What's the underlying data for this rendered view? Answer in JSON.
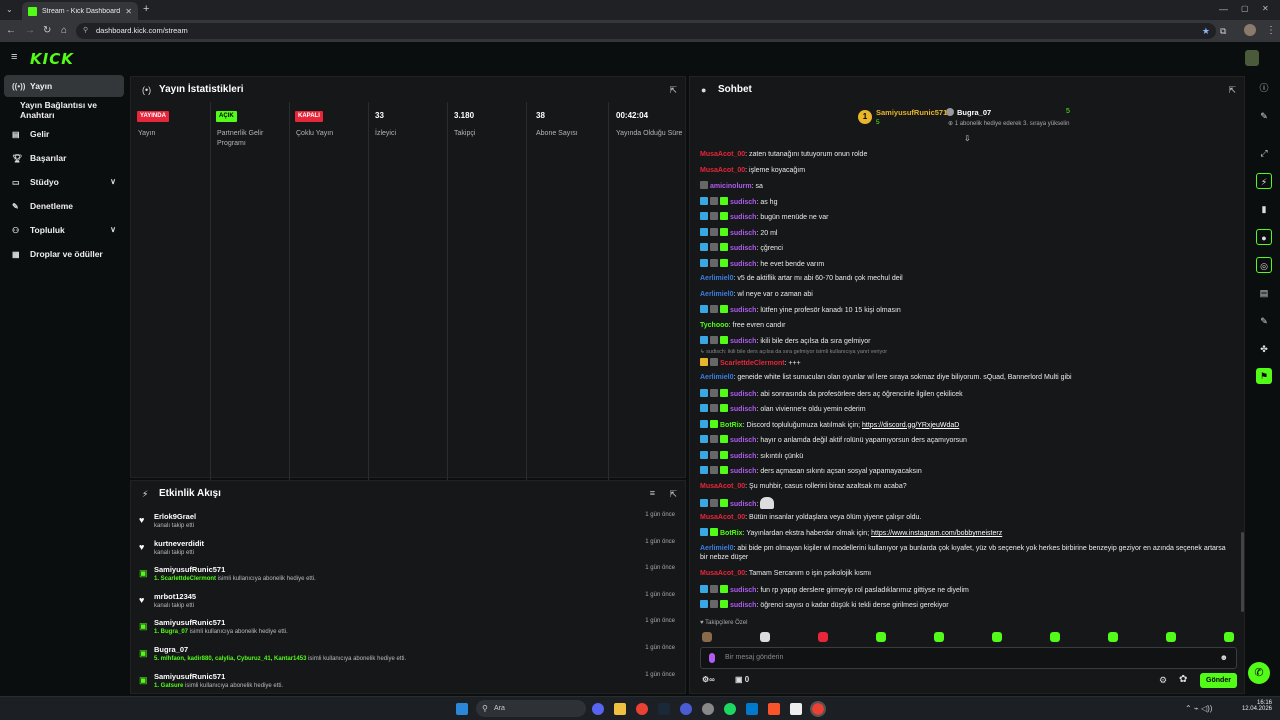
{
  "browser": {
    "tab_title": "Stream - Kick Dashboard",
    "url": "dashboard.kick.com/stream"
  },
  "brand": {
    "logo_text": "KICK",
    "accent": "#53fc18"
  },
  "sidebar": {
    "items": [
      {
        "label": "Yayın",
        "icon": "broadcast-icon",
        "active": true
      },
      {
        "label": "Yayın Bağlantısı ve Anahtarı",
        "icon": "",
        "active": false
      },
      {
        "label": "Gelir",
        "icon": "money-icon"
      },
      {
        "label": "Başarılar",
        "icon": "trophy-icon"
      },
      {
        "label": "Stüdyo",
        "icon": "studio-icon",
        "chevron": true
      },
      {
        "label": "Denetleme",
        "icon": "wrench-icon"
      },
      {
        "label": "Topluluk",
        "icon": "community-icon",
        "chevron": true
      },
      {
        "label": "Droplar ve ödüller",
        "icon": "drops-icon"
      }
    ]
  },
  "stats_panel": {
    "title": "Yayın İstatistikleri",
    "columns": [
      {
        "badge": "YAYINDA",
        "badge_color": "#e8263a",
        "label": "Yayın"
      },
      {
        "badge": "AÇIK",
        "badge_color": "#53fc18",
        "label": "Partnerlik Gelir Programı"
      },
      {
        "badge": "KAPALI",
        "badge_color": "#e8263a",
        "label": "Çoklu Yayın"
      },
      {
        "value": "33",
        "label": "İzleyici"
      },
      {
        "value": "3.180",
        "label": "Takipçi"
      },
      {
        "value": "38",
        "label": "Abone Sayısı"
      },
      {
        "value": "00:42:04",
        "label": "Yayında Olduğu Süre"
      }
    ]
  },
  "activity_panel": {
    "title": "Etkinlik Akışı",
    "items": [
      {
        "icon": "heart-icon",
        "name": "Erlok9Grael",
        "desc_pre": "",
        "desc_highlight": "",
        "desc": "kanalı takip etti",
        "time": "1 gün önce"
      },
      {
        "icon": "heart-icon",
        "name": "kurtneverdidit",
        "desc_pre": "",
        "desc_highlight": "",
        "desc": "kanalı takip etti",
        "time": "1 gün önce"
      },
      {
        "icon": "gift-icon",
        "name": "SamiyusufRunic571",
        "desc_highlight": "1. ScarlettdeClermont",
        "desc": " isimli kullanıcıya abonelik hediye etti.",
        "time": "1 gün önce"
      },
      {
        "icon": "heart-icon",
        "name": "mrbot12345",
        "desc_highlight": "",
        "desc": "kanalı takip etti",
        "time": "1 gün önce"
      },
      {
        "icon": "gift-icon",
        "name": "SamiyusufRunic571",
        "desc_highlight": "1. Bugra_07",
        "desc": " isimli kullanıcıya abonelik hediye etti.",
        "time": "1 gün önce"
      },
      {
        "icon": "gift-icon",
        "name": "Bugra_07",
        "desc_highlight": "5. mlhfaon, kadir880, calylia, Cyburuz_41, Kantar1453",
        "desc": " isimli kullanıcıya abonelik hediye etti.",
        "time": "1 gün önce"
      },
      {
        "icon": "gift-icon",
        "name": "SamiyusufRunic571",
        "desc_highlight": "1. Gatsure",
        "desc": " isimli kullanıcıya abonelik hediye etti.",
        "time": "1 gün önce"
      }
    ]
  },
  "chat_panel": {
    "title": "Sohbet",
    "leaderboard": {
      "rank": "1",
      "first_name": "SamiyusufRunic571",
      "first_count": "5",
      "second_name": "Bugra_07",
      "second_count": "5",
      "second_note": "1 abonelik hediye ederek 3. sıraya yükselin"
    },
    "messages": [
      {
        "badges": [],
        "user": "MusaAcot_00",
        "color": "#e8263a",
        "text": "zaten tutanağını tutuyorum onun rolde"
      },
      {
        "badges": [],
        "user": "MusaAcot_00",
        "color": "#e8263a",
        "text": "işleme koyacağım"
      },
      {
        "badges": [
          "gray"
        ],
        "user": "amicinolurm",
        "color": "#b05cf0",
        "text": "sa"
      },
      {
        "badges": [
          "blue",
          "gray",
          "green"
        ],
        "user": "sudisch",
        "color": "#b05cf0",
        "text": "as hg"
      },
      {
        "badges": [
          "blue",
          "gray",
          "green"
        ],
        "user": "sudisch",
        "color": "#b05cf0",
        "text": "bugün menüde ne var"
      },
      {
        "badges": [
          "blue",
          "gray",
          "green"
        ],
        "user": "sudisch",
        "color": "#b05cf0",
        "text": "20 ml"
      },
      {
        "badges": [
          "blue",
          "gray",
          "green"
        ],
        "user": "sudisch",
        "color": "#b05cf0",
        "text": "çğrenci"
      },
      {
        "badges": [
          "blue",
          "gray",
          "green"
        ],
        "user": "sudisch",
        "color": "#b05cf0",
        "text": "he evet bende varım"
      },
      {
        "badges": [],
        "user": "Aerlimiel0",
        "color": "#3a7fe4",
        "text": "v5 de aktiflik artar mı abi 60-70 bandı çok mechul deil"
      },
      {
        "badges": [],
        "user": "Aerlimiel0",
        "color": "#3a7fe4",
        "text": "wl neye var o zaman abi"
      },
      {
        "badges": [
          "blue",
          "gray",
          "green"
        ],
        "user": "sudisch",
        "color": "#b05cf0",
        "text": "lütfen yine profesör kanadı 10 15 kişi olmasın"
      },
      {
        "badges": [],
        "user": "Tychooo",
        "color": "#53fc18",
        "text": "free evren candır"
      },
      {
        "badges": [
          "blue",
          "gray",
          "green"
        ],
        "user": "sudisch",
        "color": "#b05cf0",
        "text": "ikili bile ders açılsa da sıra gelmiyor"
      },
      {
        "badges": [
          "gold",
          "gray"
        ],
        "user": "ScarlettdeClermont",
        "color": "#e8263a",
        "text": "+++",
        "reply": "sudisch: ikili bile ders açılsa da sıra gelmiyor isimli kullanıcıya yanıt veriyor"
      },
      {
        "badges": [],
        "user": "Aerlimiel0",
        "color": "#3a7fe4",
        "text": "geneide white list sunucuları olan oyunlar wl lere sıraya sokmaz diye biliyorum. sQuad, Bannerlord Multi gibi"
      },
      {
        "badges": [
          "blue",
          "gray",
          "green"
        ],
        "user": "sudisch",
        "color": "#b05cf0",
        "text": "abi sonrasında da profesörlere ders aç öğrencinle ilgilen çekilicek"
      },
      {
        "badges": [
          "blue",
          "gray",
          "green"
        ],
        "user": "sudisch",
        "color": "#b05cf0",
        "text": "olan vivienne'e oldu yemin ederim"
      },
      {
        "badges": [
          "blue",
          "green"
        ],
        "user": "BotRix",
        "color": "#53fc18",
        "text": "Discord topluluğumuza katılmak için; ",
        "link": "https://discord.gg/YRxjeuWdaD"
      },
      {
        "badges": [
          "blue",
          "gray",
          "green"
        ],
        "user": "sudisch",
        "color": "#b05cf0",
        "text": "hayır o anlamda değil aktif rolünü yapamıyorsun ders açamıyorsun"
      },
      {
        "badges": [
          "blue",
          "gray",
          "green"
        ],
        "user": "sudisch",
        "color": "#b05cf0",
        "text": "sıkıntılı çünkü"
      },
      {
        "badges": [
          "blue",
          "gray",
          "green"
        ],
        "user": "sudisch",
        "color": "#b05cf0",
        "text": "ders açmasan sıkıntı açsan sosyal yapamayacaksın"
      },
      {
        "badges": [],
        "user": "MusaAcot_00",
        "color": "#e8263a",
        "text": "Şu muhbir, casus rollerini biraz azaltsak mı acaba?"
      },
      {
        "badges": [
          "blue",
          "gray",
          "green"
        ],
        "user": "sudisch",
        "color": "#b05cf0",
        "text": "",
        "emote": true
      },
      {
        "badges": [],
        "user": "MusaAcot_00",
        "color": "#e8263a",
        "text": "Bütün insanlar yoldaşlara veya ölüm yiyene çalışır oldu."
      },
      {
        "badges": [
          "blue",
          "green"
        ],
        "user": "BotRix",
        "color": "#53fc18",
        "text": "Yayınlardan ekstra haberdar olmak için; ",
        "link": "https://www.instagram.com/bobbymeisterz"
      },
      {
        "badges": [],
        "user": "Aerlimiel0",
        "color": "#3a7fe4",
        "text": "abi bide pm olmayan kişiler wl modellerini kullanıyor ya bunlarda çok kıyafet, yüz vb seçenek yok herkes birbirine benzeyip geziyor en azında seçenek artarsa bir nebze düşer",
        "wrap": true
      },
      {
        "badges": [],
        "user": "MusaAcot_00",
        "color": "#e8263a",
        "text": "Tamam Sercanım o işin psikolojik kısmı"
      },
      {
        "badges": [
          "blue",
          "gray",
          "green"
        ],
        "user": "sudisch",
        "color": "#b05cf0",
        "text": "fun rp yapıp derslere girmeyip rol pasladıklarımız gittiyse ne diyelim"
      },
      {
        "badges": [
          "blue",
          "gray",
          "green"
        ],
        "user": "sudisch",
        "color": "#b05cf0",
        "text": "öğrenci sayısı o kadar düşük ki tekli derse girilmesi gerekiyor"
      }
    ],
    "followers_label": "Takipçilere Özel",
    "input_placeholder": "Bir mesaj gönderin",
    "infinity": "∞",
    "points": "0",
    "send_label": "Gönder"
  },
  "taskbar": {
    "search_placeholder": "Ara",
    "time": "16:16",
    "date": "12.04.2026"
  }
}
